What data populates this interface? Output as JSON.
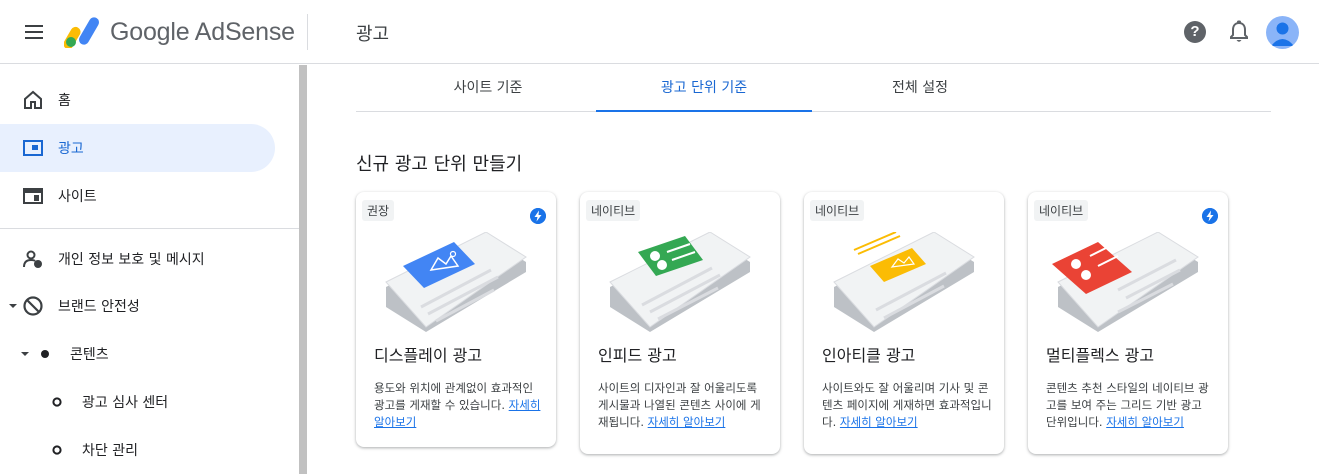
{
  "header": {
    "brand": "Google AdSense",
    "title": "광고"
  },
  "sidebar": {
    "items": [
      {
        "label": "홈",
        "icon": "home-icon"
      },
      {
        "label": "광고",
        "icon": "ads-icon"
      },
      {
        "label": "사이트",
        "icon": "site-icon"
      },
      {
        "label": "개인 정보 보호 및 메시지",
        "icon": "privacy-icon"
      },
      {
        "label": "브랜드 안전성",
        "icon": "block-icon"
      },
      {
        "label": "콘텐츠",
        "icon": "dot-icon"
      },
      {
        "label": "광고 심사 센터",
        "icon": "circle-icon"
      },
      {
        "label": "차단 관리",
        "icon": "circle-icon"
      }
    ]
  },
  "tabs": [
    {
      "label": "사이트 기준"
    },
    {
      "label": "광고 단위 기준"
    },
    {
      "label": "전체 설정"
    }
  ],
  "section_title": "신규 광고 단위 만들기",
  "cards": [
    {
      "badge": "권장",
      "title": "디스플레이 광고",
      "desc": "용도와 위치에 관계없이 효과적인 광고를 게재할 수 있습니다.",
      "link": "자세히 알아보기",
      "color": "#4285f4"
    },
    {
      "badge": "네이티브",
      "title": "인피드 광고",
      "desc": "사이트의 디자인과 잘 어울리도록 게시물과 나열된 콘텐츠 사이에 게재됩니다.",
      "link": "자세히 알아보기",
      "color": "#34a853"
    },
    {
      "badge": "네이티브",
      "title": "인아티클 광고",
      "desc": "사이트와도 잘 어울리며 기사 및 콘텐츠 페이지에 게재하면 효과적입니다.",
      "link": "자세히 알아보기",
      "color": "#fbbc04"
    },
    {
      "badge": "네이티브",
      "title": "멀티플렉스 광고",
      "desc": "콘텐츠 추천 스타일의 네이티브 광고를 보여 주는 그리드 기반 광고 단위입니다.",
      "link": "자세히 알아보기",
      "color": "#ea4335"
    }
  ],
  "colors": {
    "accent": "#1a73e8",
    "active_bg": "#e8f0fe"
  }
}
